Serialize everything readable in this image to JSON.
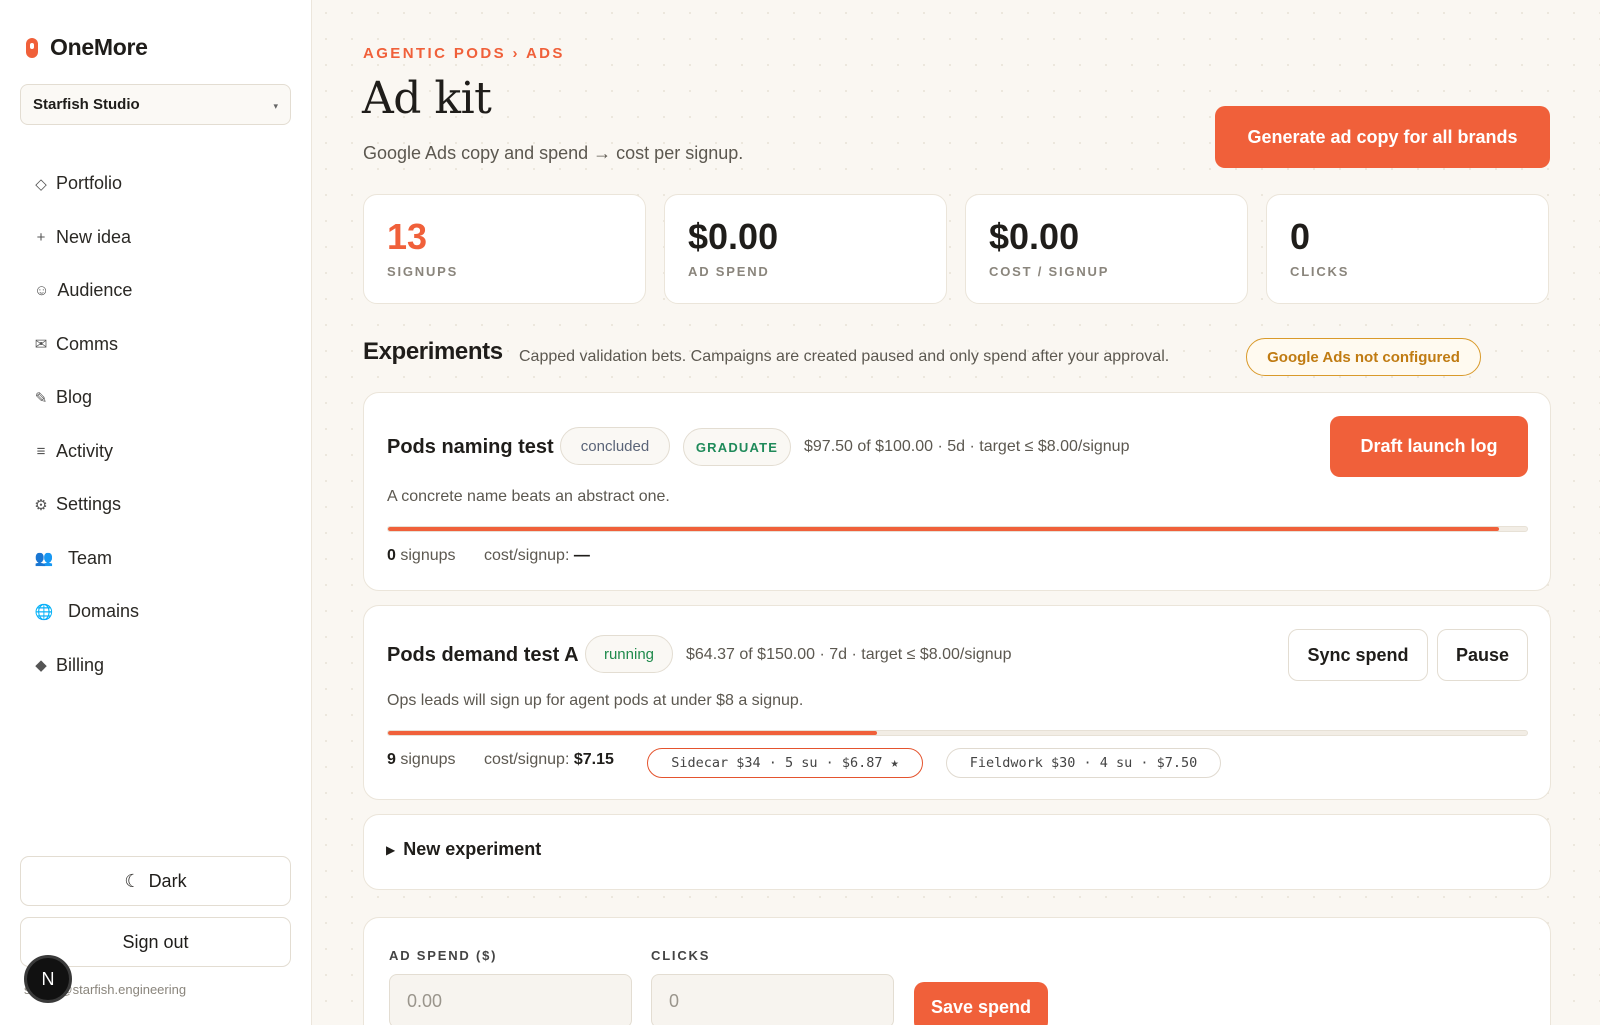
{
  "app": {
    "name": "OneMore"
  },
  "workspace": {
    "name": "Starfish Studio",
    "caret": "▾"
  },
  "nav": [
    {
      "icon": "◇",
      "label": "Portfolio"
    },
    {
      "icon": "+",
      "label": "New idea"
    },
    {
      "icon": "☺",
      "label": "Audience"
    },
    {
      "icon": "✉",
      "label": "Comms"
    },
    {
      "icon": "✎",
      "label": "Blog"
    },
    {
      "icon": "≡",
      "label": "Activity"
    },
    {
      "icon": "⚙",
      "label": "Settings"
    },
    {
      "icon": "👥",
      "label": "Team"
    },
    {
      "icon": "🌐",
      "label": "Domains"
    },
    {
      "icon": "◆",
      "label": "Billing"
    }
  ],
  "sidebar_footer": {
    "theme_icon": "☾",
    "theme_label": "Dark",
    "signout_label": "Sign out",
    "email": "shaun@starfish.engineering",
    "avatar_letter": "N"
  },
  "header": {
    "breadcrumb": "AGENTIC PODS › ADS",
    "title": "Ad kit",
    "subtitle": "Google Ads copy and spend → cost per signup.",
    "generate_label": "Generate ad copy for all brands"
  },
  "stats": [
    {
      "value": "13",
      "label": "SIGNUPS",
      "accent": true
    },
    {
      "value": "$0.00",
      "label": "AD SPEND",
      "accent": false
    },
    {
      "value": "$0.00",
      "label": "COST / SIGNUP",
      "accent": false
    },
    {
      "value": "0",
      "label": "CLICKS",
      "accent": false
    }
  ],
  "experiments": {
    "title": "Experiments",
    "description": "Capped validation bets. Campaigns are created paused and only spend after your approval.",
    "warning": "Google Ads not configured",
    "items": [
      {
        "name": "Pods naming test",
        "status": "concluded",
        "verdict": "GRADUATE",
        "meta": "$97.50 of $100.00 · 5d · target ≤ $8.00/signup",
        "hypothesis": "A concrete name beats an abstract one.",
        "progress": 0.975,
        "signups": "0",
        "signups_label": "signups",
        "cost_label": "cost/signup:",
        "cost_value": "—",
        "action_label": "Draft launch log"
      },
      {
        "name": "Pods demand test A",
        "status": "running",
        "meta": "$64.37 of $150.00 · 7d · target ≤ $8.00/signup",
        "hypothesis": "Ops leads will sign up for agent pods at under $8 a signup.",
        "progress": 0.429,
        "signups": "9",
        "signups_label": "signups",
        "cost_label": "cost/signup:",
        "cost_value": "$7.15",
        "variants": [
          {
            "text": "Sidecar $34 · 5 su · $6.87 ★",
            "best": true
          },
          {
            "text": "Fieldwork $30 · 4 su · $7.50",
            "best": false
          }
        ],
        "sync_label": "Sync spend",
        "pause_label": "Pause"
      }
    ],
    "new_label": "New experiment",
    "new_icon": "▶"
  },
  "spend_form": {
    "ad_spend_label": "AD SPEND ($)",
    "ad_spend_placeholder": "0.00",
    "clicks_label": "CLICKS",
    "clicks_placeholder": "0",
    "save_label": "Save spend"
  },
  "colors": {
    "accent": "#f0603a",
    "warning": "#c07b12",
    "success": "#1f8a4c"
  }
}
